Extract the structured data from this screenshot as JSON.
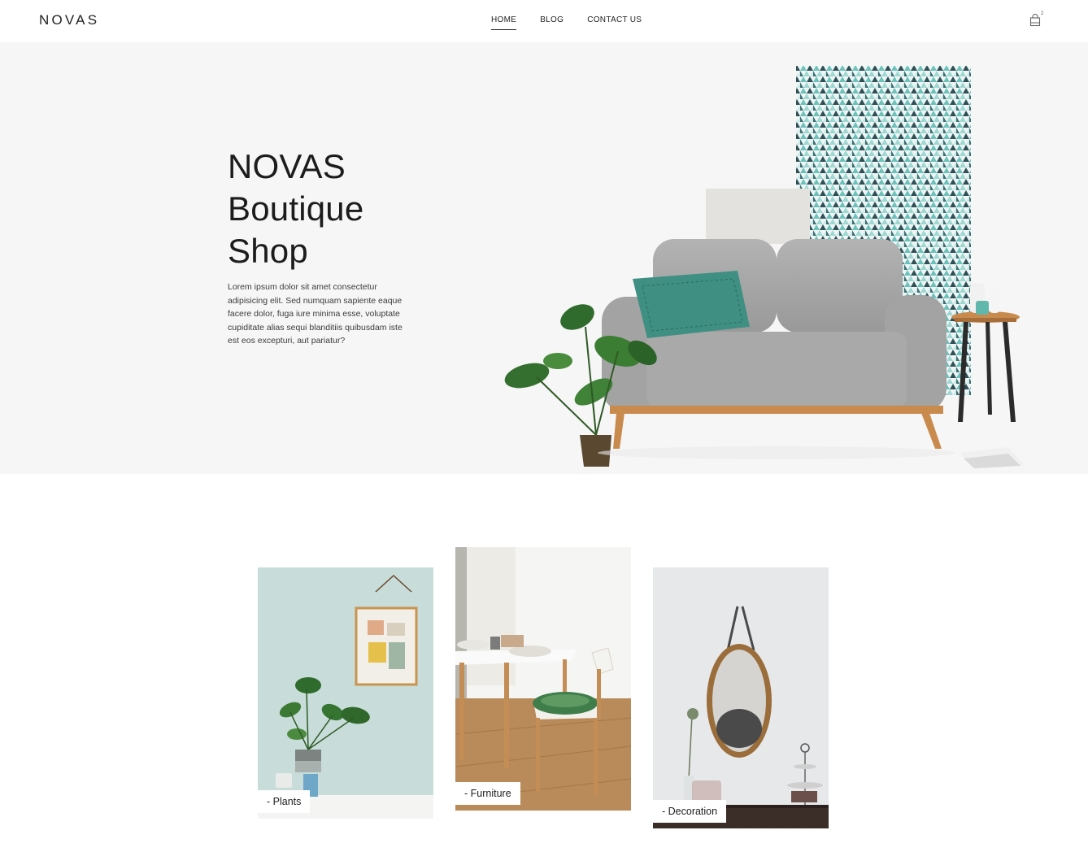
{
  "header": {
    "logo": "NOVAS",
    "nav": [
      {
        "label": "HOME",
        "active": true
      },
      {
        "label": "BLOG",
        "active": false
      },
      {
        "label": "CONTACT US",
        "active": false
      }
    ],
    "cart_icon": "shopping-bag-icon",
    "cart_count": "2"
  },
  "hero": {
    "title_line1": "NOVAS",
    "title_line2": "Boutique",
    "title_line3": "Shop",
    "description": "Lorem ipsum dolor sit amet consectetur adipisicing elit. Sed numquam sapiente eaque facere dolor, fuga iure minima esse, voluptate cupiditate alias sequi blanditiis quibusdam iste est eos excepturi, aut pariatur?"
  },
  "categories": [
    {
      "label": "- Plants"
    },
    {
      "label": "- Furniture"
    },
    {
      "label": "- Decoration"
    }
  ],
  "colors": {
    "hero_bg": "#f6f6f6",
    "sofa": "#a7a7a7",
    "teal_accent": "#3f8f83",
    "wood": "#c98a4e"
  }
}
